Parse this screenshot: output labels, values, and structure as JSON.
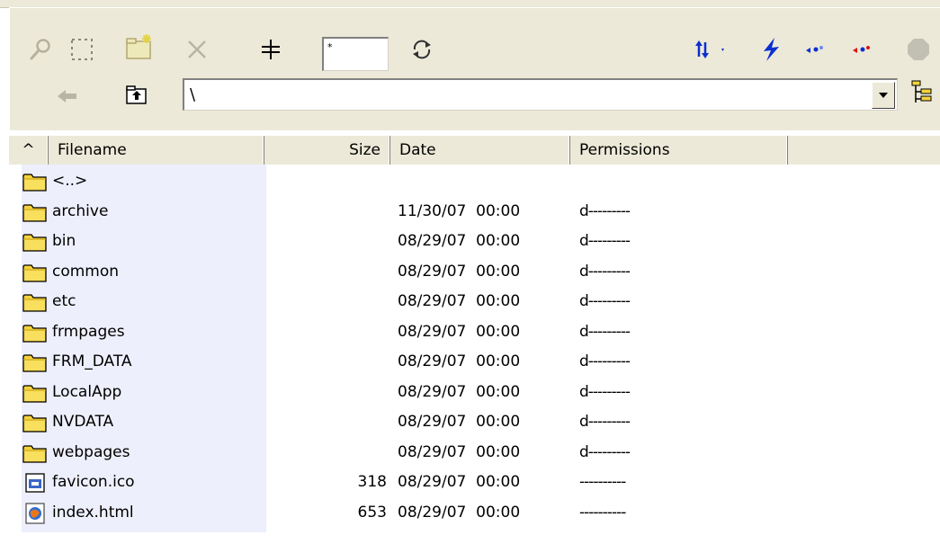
{
  "toolbar": {
    "filter_value": "*",
    "path_value": "\\"
  },
  "columns": {
    "sort_indicator": "^",
    "filename": "Filename",
    "size": "Size",
    "date": "Date",
    "permissions": "Permissions"
  },
  "files": [
    {
      "name": "<..>",
      "size": "",
      "date": "",
      "permissions": "",
      "icon": "folder-icon"
    },
    {
      "name": "archive",
      "size": "",
      "date": "11/30/07  00:00",
      "permissions": "d---------",
      "icon": "folder-icon"
    },
    {
      "name": "bin",
      "size": "",
      "date": "08/29/07  00:00",
      "permissions": "d---------",
      "icon": "folder-icon"
    },
    {
      "name": "common",
      "size": "",
      "date": "08/29/07  00:00",
      "permissions": "d---------",
      "icon": "folder-icon"
    },
    {
      "name": "etc",
      "size": "",
      "date": "08/29/07  00:00",
      "permissions": "d---------",
      "icon": "folder-icon"
    },
    {
      "name": "frmpages",
      "size": "",
      "date": "08/29/07  00:00",
      "permissions": "d---------",
      "icon": "folder-icon"
    },
    {
      "name": "FRM_DATA",
      "size": "",
      "date": "08/29/07  00:00",
      "permissions": "d---------",
      "icon": "folder-icon"
    },
    {
      "name": "LocalApp",
      "size": "",
      "date": "08/29/07  00:00",
      "permissions": "d---------",
      "icon": "folder-icon"
    },
    {
      "name": "NVDATA",
      "size": "",
      "date": "08/29/07  00:00",
      "permissions": "d---------",
      "icon": "folder-icon"
    },
    {
      "name": "webpages",
      "size": "",
      "date": "08/29/07  00:00",
      "permissions": "d---------",
      "icon": "folder-icon"
    },
    {
      "name": "favicon.ico",
      "size": "318",
      "date": "08/29/07  00:00",
      "permissions": "----------",
      "icon": "ico-file-icon"
    },
    {
      "name": "index.html",
      "size": "653",
      "date": "08/29/07  00:00",
      "permissions": "----------",
      "icon": "html-file-icon"
    }
  ],
  "colors": {
    "toolbar_bg": "#ece9d8",
    "name_column_highlight": "#eeeffc",
    "folder_yellow": "#f5d23c",
    "accent_blue": "#0b2fd0",
    "accent_red": "#e01010"
  }
}
